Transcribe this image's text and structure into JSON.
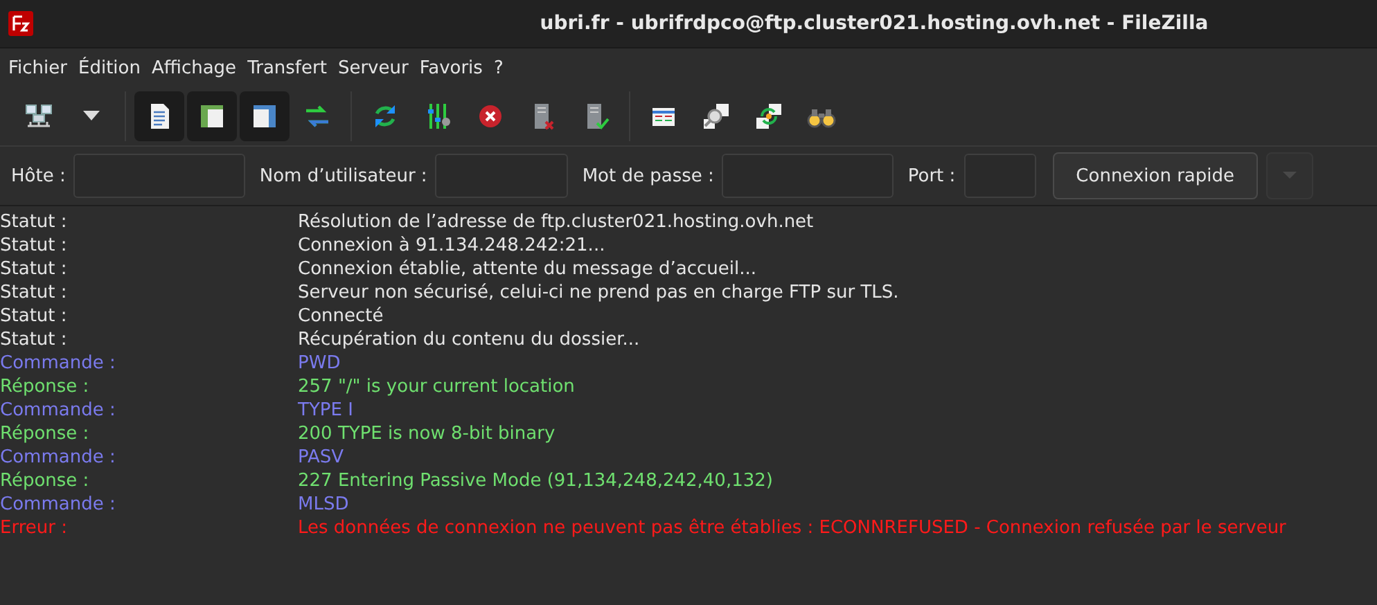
{
  "window": {
    "title": "ubri.fr - ubrifrdpco@ftp.cluster021.hosting.ovh.net - FileZilla"
  },
  "menu": [
    "Fichier",
    "Édition",
    "Affichage",
    "Transfert",
    "Serveur",
    "Favoris",
    "?"
  ],
  "toolbar": [
    [
      {
        "kind": "site-manager",
        "pressed": false
      },
      {
        "kind": "dropdown",
        "pressed": false
      }
    ],
    [
      {
        "kind": "message-log",
        "pressed": true
      },
      {
        "kind": "local-tree",
        "pressed": true
      },
      {
        "kind": "remote-tree",
        "pressed": true
      },
      {
        "kind": "transfer-queue",
        "pressed": false
      }
    ],
    [
      {
        "kind": "refresh",
        "pressed": false
      },
      {
        "kind": "filter",
        "pressed": false
      },
      {
        "kind": "cancel",
        "pressed": false
      },
      {
        "kind": "disconnect",
        "pressed": false
      },
      {
        "kind": "reconnect",
        "pressed": false
      }
    ],
    [
      {
        "kind": "compare",
        "pressed": false
      },
      {
        "kind": "search",
        "pressed": false
      },
      {
        "kind": "sync",
        "pressed": false
      },
      {
        "kind": "find",
        "pressed": false
      }
    ]
  ],
  "quickconnect": {
    "fields": [
      {
        "label": "Hôte :",
        "kind": "wide"
      },
      {
        "label": "Nom d’utilisateur :",
        "kind": "medium"
      },
      {
        "label": "Mot de passe :",
        "kind": "wide"
      },
      {
        "label": "Port :",
        "kind": "narrow"
      }
    ],
    "button": "Connexion rapide",
    "dropdown": {
      "disabled": true
    }
  },
  "log": [
    {
      "kind": "status",
      "label": "Statut :",
      "message": "Résolution de l’adresse de ftp.cluster021.hosting.ovh.net"
    },
    {
      "kind": "status",
      "label": "Statut :",
      "message": "Connexion à 91.134.248.242:21..."
    },
    {
      "kind": "status",
      "label": "Statut :",
      "message": "Connexion établie, attente du message d’accueil..."
    },
    {
      "kind": "status",
      "label": "Statut :",
      "message": "Serveur non sécurisé, celui-ci ne prend pas en charge FTP sur TLS."
    },
    {
      "kind": "status",
      "label": "Statut :",
      "message": "Connecté"
    },
    {
      "kind": "status",
      "label": "Statut :",
      "message": "Récupération du contenu du dossier..."
    },
    {
      "kind": "command",
      "label": "Commande :",
      "message": "PWD"
    },
    {
      "kind": "response",
      "label": "Réponse :",
      "message": "257 \"/\" is your current location"
    },
    {
      "kind": "command",
      "label": "Commande :",
      "message": "TYPE I"
    },
    {
      "kind": "response",
      "label": "Réponse :",
      "message": "200 TYPE is now 8-bit binary"
    },
    {
      "kind": "command",
      "label": "Commande :",
      "message": "PASV"
    },
    {
      "kind": "response",
      "label": "Réponse :",
      "message": "227 Entering Passive Mode (91,134,248,242,40,132)"
    },
    {
      "kind": "command",
      "label": "Commande :",
      "message": "MLSD"
    },
    {
      "kind": "error",
      "label": "Erreur :",
      "message": "Les données de connexion ne peuvent pas être établies : ECONNREFUSED - Connexion refusée par le serveur"
    }
  ]
}
